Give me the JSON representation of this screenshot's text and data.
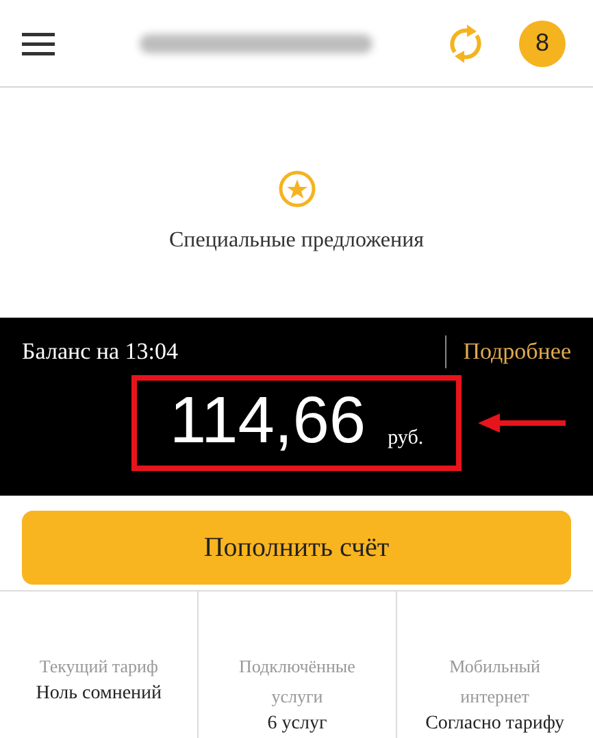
{
  "header": {
    "notifications": "8"
  },
  "offers": {
    "label": "Специальные предложения"
  },
  "balance": {
    "label": "Баланс на 13:04",
    "details_link": "Подробнее",
    "amount": "114,66",
    "currency": "руб."
  },
  "top_up_button": "Пополнить счёт",
  "summary": [
    {
      "label": "Текущий тариф",
      "value": "Ноль сомнений"
    },
    {
      "label": "Подключённые услуги",
      "value": "6 услуг"
    },
    {
      "label": "Мобильный интернет",
      "value": "Согласно тарифу"
    }
  ]
}
